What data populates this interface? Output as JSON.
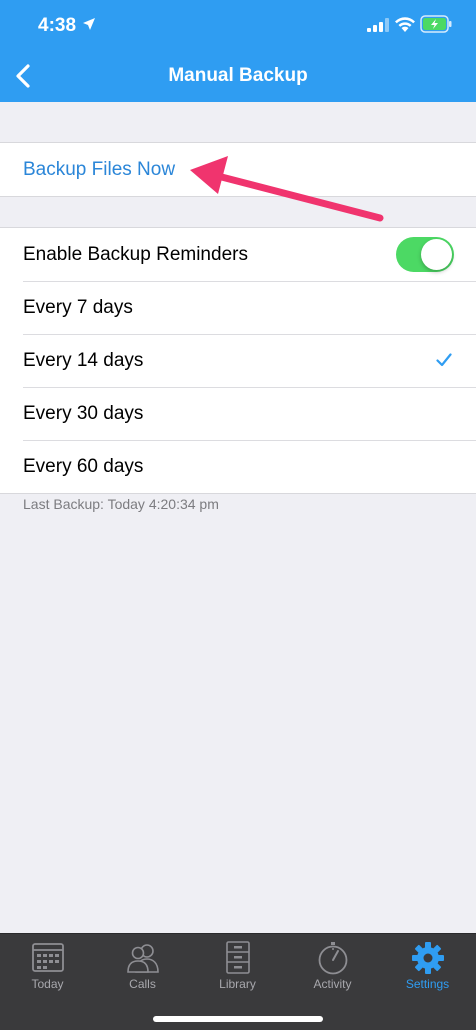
{
  "status": {
    "time": "4:38"
  },
  "nav": {
    "title": "Manual Backup"
  },
  "backup_now_label": "Backup Files Now",
  "reminders": {
    "enable_label": "Enable Backup Reminders",
    "enabled": true,
    "options": [
      "Every 7 days",
      "Every 14 days",
      "Every 30 days",
      "Every 60 days"
    ],
    "selected": "Every 14 days"
  },
  "last_backup": "Last Backup: Today 4:20:34 pm",
  "tabs": [
    {
      "label": "Today",
      "icon": "calendar-icon"
    },
    {
      "label": "Calls",
      "icon": "people-icon"
    },
    {
      "label": "Library",
      "icon": "file-cabinet-icon"
    },
    {
      "label": "Activity",
      "icon": "stopwatch-icon"
    },
    {
      "label": "Settings",
      "icon": "gear-icon",
      "active": true
    }
  ],
  "colors": {
    "header": "#2f9df2",
    "link": "#2b86d8",
    "toggle_on": "#4cd964",
    "annotation_arrow": "#f0346e",
    "tab_active": "#2f9df2",
    "tab_bar": "#3a3a3c"
  }
}
